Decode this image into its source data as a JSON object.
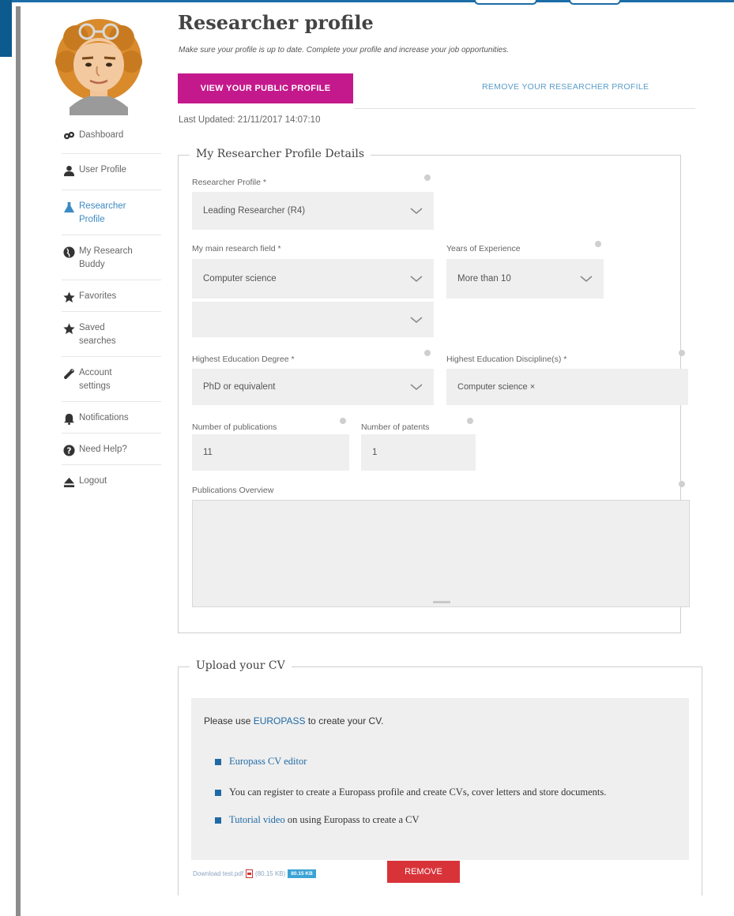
{
  "header": {
    "title": "Researcher profile",
    "subtitle": "Make sure your profile is up to date. Complete your profile and increase your job opportunities.",
    "view_public_profile": "VIEW YOUR PUBLIC PROFILE",
    "remove_profile": "REMOVE YOUR RESEARCHER PROFILE",
    "last_updated": "Last Updated: 21/11/2017 14:07:10"
  },
  "sidebar": {
    "items": [
      {
        "label": "Dashboard",
        "icon": "dashboard-icon"
      },
      {
        "label": "User Profile",
        "icon": "user-icon"
      },
      {
        "label": "Researcher Profile",
        "icon": "flask-icon",
        "active": true
      },
      {
        "label": "My Research Buddy",
        "icon": "globe-icon"
      },
      {
        "label": "Favorites",
        "icon": "star-icon"
      },
      {
        "label": "Saved searches",
        "icon": "star-icon"
      },
      {
        "label": "Account settings",
        "icon": "wrench-icon"
      },
      {
        "label": "Notifications",
        "icon": "bell-icon"
      },
      {
        "label": "Need Help?",
        "icon": "question-icon"
      },
      {
        "label": "Logout",
        "icon": "eject-icon"
      }
    ]
  },
  "details": {
    "legend": "My Researcher Profile Details",
    "researcher_profile_label": "Researcher Profile *",
    "researcher_profile_value": "Leading Researcher (R4)",
    "research_field_label": "My main research field *",
    "research_field_value": "Computer science",
    "research_field_secondary_value": "",
    "years_label": "Years of Experience",
    "years_value": "More than 10",
    "education_degree_label": "Highest Education Degree *",
    "education_degree_value": "PhD or equivalent",
    "education_discipline_label": "Highest Education Discipline(s) *",
    "education_discipline_tag": "Computer science ×",
    "publications_label": "Number of publications",
    "publications_value": "11",
    "patents_label": "Number of patents",
    "patents_value": "1",
    "overview_label": "Publications Overview",
    "overview_value": ""
  },
  "cv": {
    "legend": "Upload your CV",
    "intro_before": "Please use ",
    "intro_link": "EUROPASS",
    "intro_after": " to create your CV.",
    "item1_link": "Europass CV editor",
    "item2_text": "You can register to create a Europass profile and create CVs, cover letters and store documents.",
    "item3_link": "Tutorial video",
    "item3_after": " on using Europass to create a CV",
    "file_link": "Download test.pdf",
    "file_size": "(80.15 KB)",
    "file_badge": "80.15 KB",
    "remove_button": "REMOVE"
  },
  "colors": {
    "accent_magenta": "#c4198c",
    "link_blue": "#1f6aa5",
    "remove_red": "#d9333a",
    "frame_blue": "#0d5a8f"
  }
}
